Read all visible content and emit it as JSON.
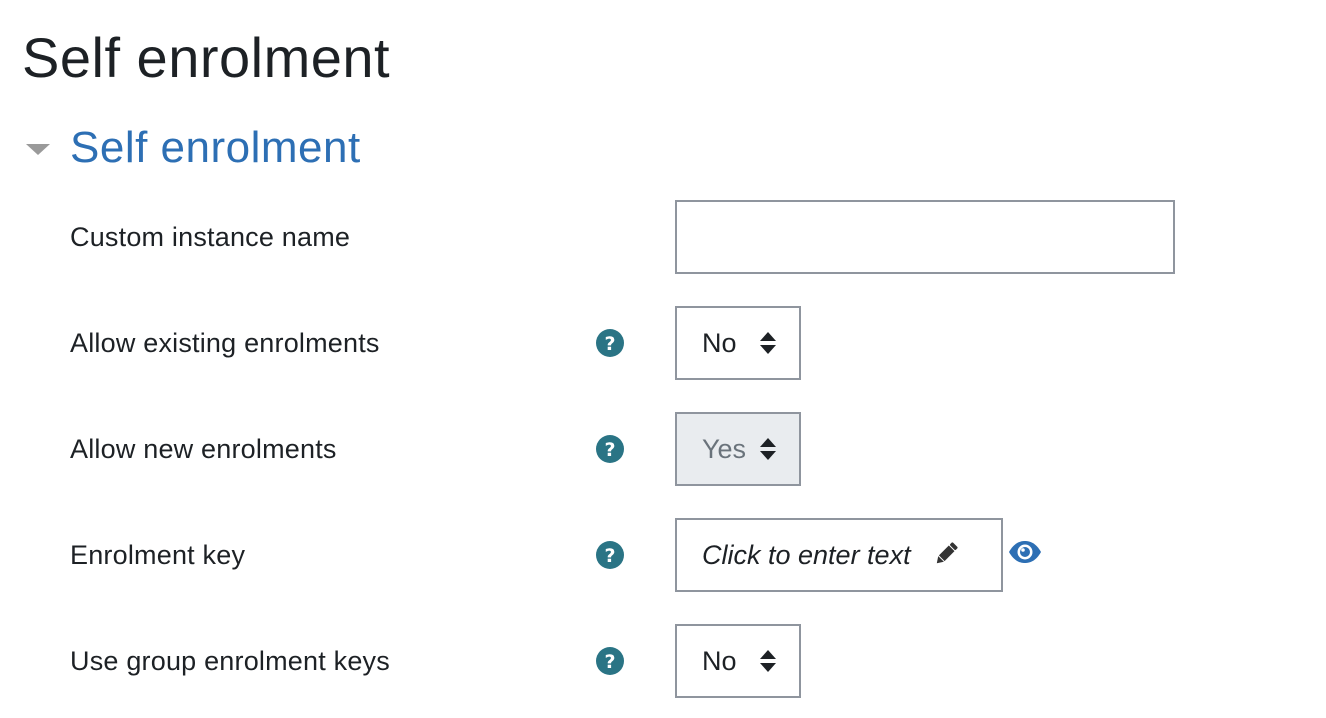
{
  "page": {
    "title": "Self enrolment"
  },
  "section": {
    "title": "Self enrolment",
    "collapse_icon": "caret-down-icon"
  },
  "colors": {
    "accent": "#2d6fb4",
    "help_icon": "#2a7485",
    "border": "#8f959e",
    "disabled_bg": "#e9ecef"
  },
  "fields": {
    "custom_instance_name": {
      "label": "Custom instance name",
      "value": "",
      "placeholder": ""
    },
    "allow_existing_enrolments": {
      "label": "Allow existing enrolments",
      "help_icon": "question-circle-icon",
      "selected": "No"
    },
    "allow_new_enrolments": {
      "label": "Allow new enrolments",
      "help_icon": "question-circle-icon",
      "selected": "Yes",
      "disabled": true
    },
    "enrolment_key": {
      "label": "Enrolment key",
      "help_icon": "question-circle-icon",
      "placeholder_text": "Click to enter text",
      "edit_icon": "pencil-icon",
      "reveal_icon": "eye-icon"
    },
    "use_group_enrolment_keys": {
      "label": "Use group enrolment keys",
      "help_icon": "question-circle-icon",
      "selected": "No"
    }
  }
}
